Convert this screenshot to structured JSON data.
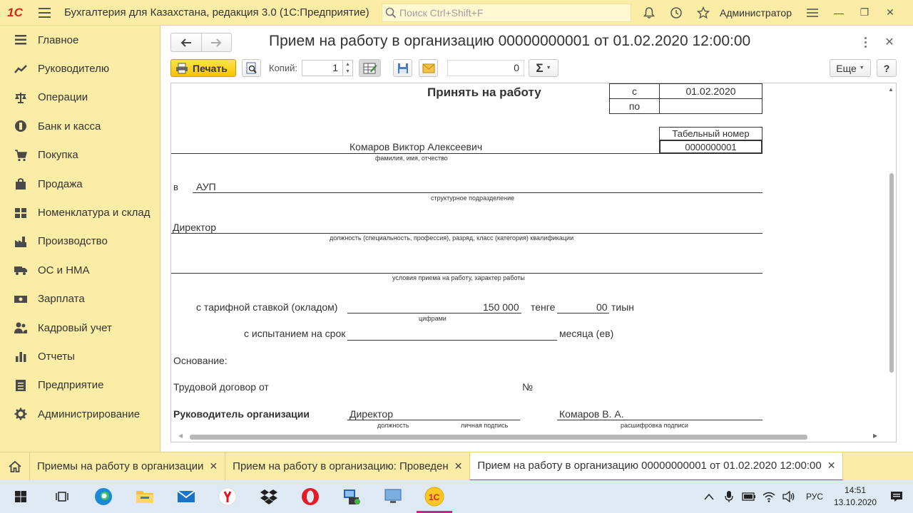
{
  "app": {
    "logo_text": "1С",
    "title": "Бухгалтерия для Казахстана, редакция 3.0  (1С:Предприятие)",
    "search_placeholder": "Поиск Ctrl+Shift+F",
    "user": "Администратор"
  },
  "sidebar": {
    "items": [
      {
        "label": "Главное",
        "icon": "menu-lines-icon"
      },
      {
        "label": "Руководителю",
        "icon": "trend-chart-icon"
      },
      {
        "label": "Операции",
        "icon": "scales-icon"
      },
      {
        "label": "Банк и касса",
        "icon": "coin-icon"
      },
      {
        "label": "Покупка",
        "icon": "cart-icon"
      },
      {
        "label": "Продажа",
        "icon": "bag-icon"
      },
      {
        "label": "Номенклатура и склад",
        "icon": "grid-icon"
      },
      {
        "label": "Производство",
        "icon": "factory-icon"
      },
      {
        "label": "ОС и НМА",
        "icon": "truck-icon"
      },
      {
        "label": "Зарплата",
        "icon": "money-icon"
      },
      {
        "label": "Кадровый учет",
        "icon": "people-icon"
      },
      {
        "label": "Отчеты",
        "icon": "bar-chart-icon"
      },
      {
        "label": "Предприятие",
        "icon": "document-icon"
      },
      {
        "label": "Администрирование",
        "icon": "gear-icon"
      }
    ]
  },
  "form": {
    "title": "Прием на работу в организацию 00000000001 от 01.02.2020 12:00:00",
    "print_label": "Печать",
    "copies_label": "Копий:",
    "copies_value": "1",
    "sum_value": "0",
    "sum_symbol": "Σ",
    "more_label": "Еще",
    "help_label": "?"
  },
  "document": {
    "heading": "Принять на работу",
    "from_label": "с",
    "from_date": "01.02.2020",
    "to_label": "по",
    "to_date": "",
    "tab_number_label": "Табельный номер",
    "tab_number": "0000000001",
    "employee_name": "Комаров Виктор Алексеевич",
    "employee_name_caption": "фамилия, имя, отчество",
    "in_label": "в",
    "department": "АУП",
    "department_caption": "структурное подразделение",
    "position": "Директор",
    "position_caption": "должность (специальность, профессия), разряд, класс (категория) квалификации",
    "conditions_caption": "условия приема на работу, характер работы",
    "salary_label": "с тарифной ставкой (окладом)",
    "salary_value": "150 000",
    "salary_caption": "цифрами",
    "currency": "тенге",
    "cents_value": "00",
    "cents_unit": "тиын",
    "trial_label": "с испытанием на срок",
    "trial_unit": "месяца (ев)",
    "basis_label": "Основание:",
    "contract_label": "Трудовой договор от",
    "number_sign": "№",
    "head_label": "Руководитель организации",
    "head_position": "Директор",
    "head_position_caption": "должность",
    "signature_caption": "личная подпись",
    "head_name": "Комаров В. А.",
    "head_name_caption": "расшифровка  подписи"
  },
  "open_windows": {
    "tabs": [
      {
        "label": "Приемы на работу в организации"
      },
      {
        "label": "Прием на работу в организацию: Проведен"
      },
      {
        "label": "Прием на работу в организацию 00000000001 от 01.02.2020 12:00:00"
      }
    ]
  },
  "taskbar": {
    "lang": "РУС",
    "time": "14:51",
    "date": "13.10.2020"
  }
}
